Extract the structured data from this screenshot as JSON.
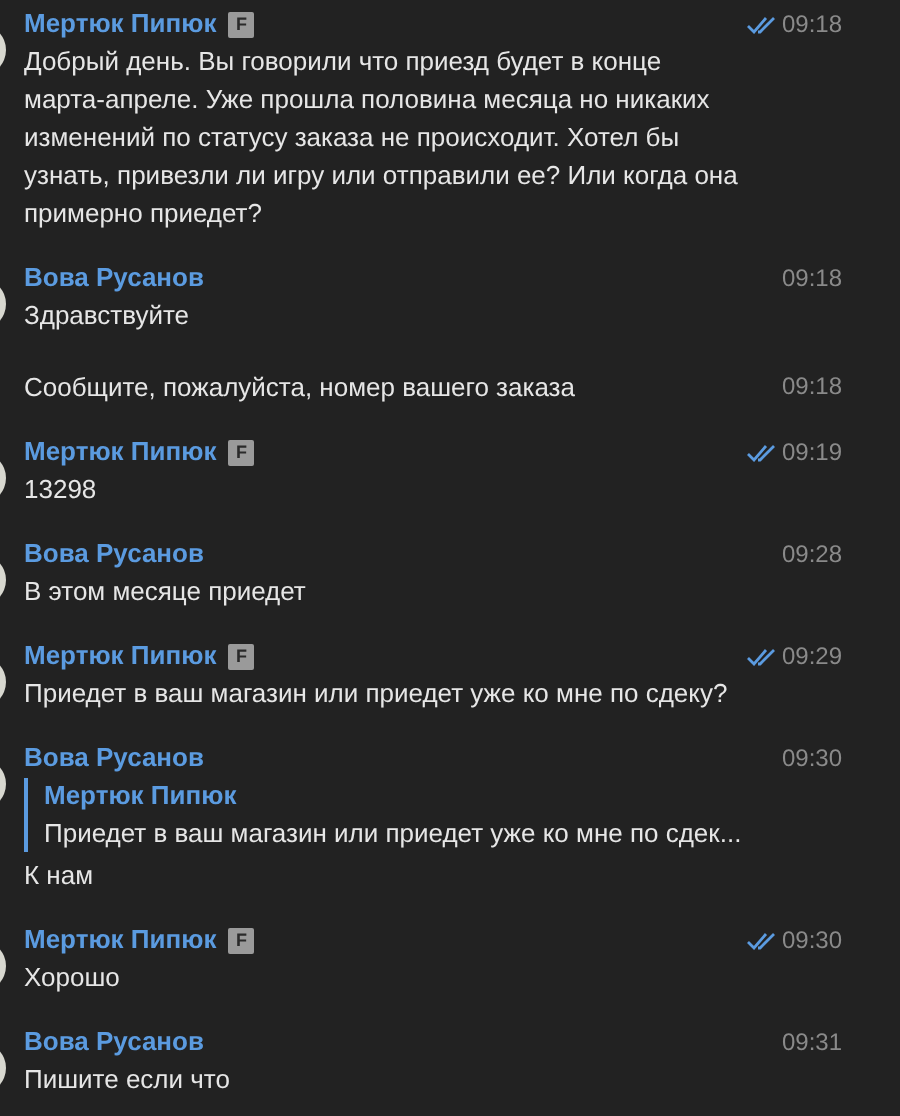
{
  "messages": [
    {
      "kind": "header",
      "author": "Мертюк Пипюк",
      "badge": "F",
      "read": true,
      "time": "09:18",
      "text": "Добрый день. Вы говорили что приезд будет в конце марта-апреле. Уже прошла половина месяца но никаких изменений по статусу заказа не происходит. Хотел бы узнать, привезли ли игру или отправили ее? Или когда она примерно приедет?"
    },
    {
      "kind": "header",
      "author": "Вова Русанов",
      "read": false,
      "time": "09:18",
      "text": "Здравствуйте"
    },
    {
      "kind": "continuation",
      "read": false,
      "time": "09:18",
      "text": "Сообщите, пожалуйста, номер вашего заказа"
    },
    {
      "kind": "header",
      "author": "Мертюк Пипюк",
      "badge": "F",
      "read": true,
      "time": "09:19",
      "text": "13298"
    },
    {
      "kind": "header",
      "author": "Вова Русанов",
      "read": false,
      "time": "09:28",
      "text": "В этом месяце приедет"
    },
    {
      "kind": "header",
      "author": "Мертюк Пипюк",
      "badge": "F",
      "read": true,
      "time": "09:29",
      "text": "Приедет в ваш магазин или приедет уже ко мне по сдеку?"
    },
    {
      "kind": "header",
      "author": "Вова Русанов",
      "read": false,
      "time": "09:30",
      "reply": {
        "author": "Мертюк Пипюк",
        "text": "Приедет в ваш магазин или приедет уже ко мне по сдек..."
      },
      "text": "К нам"
    },
    {
      "kind": "header",
      "author": "Мертюк Пипюк",
      "badge": "F",
      "read": true,
      "time": "09:30",
      "text": "Хорошо"
    },
    {
      "kind": "header",
      "author": "Вова Русанов",
      "read": false,
      "time": "09:31",
      "text": "Пишите если что"
    }
  ]
}
